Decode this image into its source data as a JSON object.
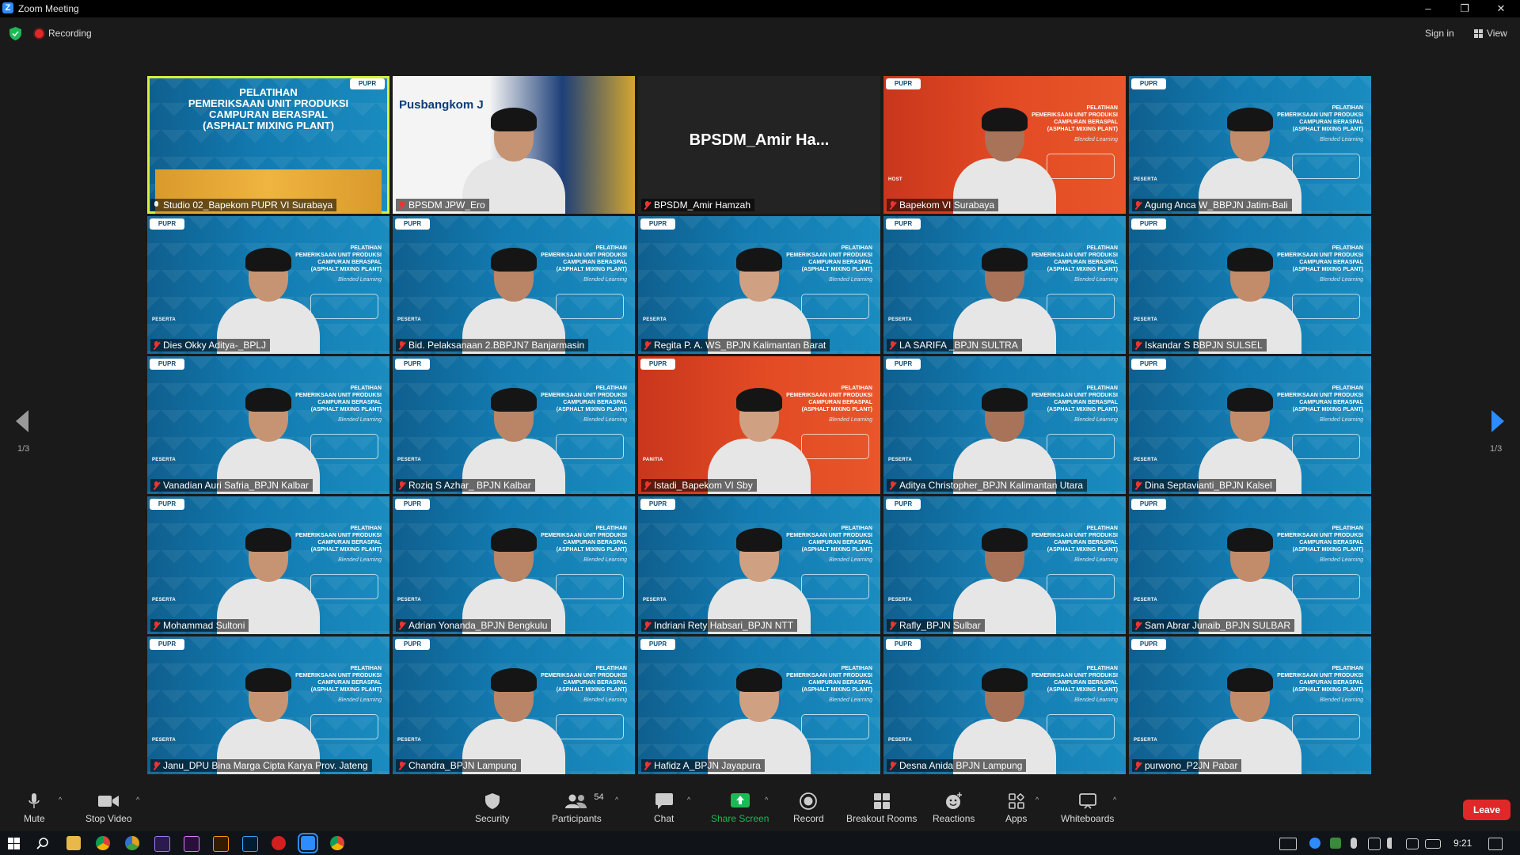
{
  "window": {
    "title": "Zoom Meeting",
    "minimize": "–",
    "restore": "❐",
    "close": "✕"
  },
  "meeting": {
    "recording_label": "Recording",
    "sign_in": "Sign in",
    "view_label": "View"
  },
  "pagination": {
    "left": "1/3",
    "right": "1/3"
  },
  "studio_banner": [
    "PELATIHAN",
    "PEMERIKSAAN UNIT PRODUKSI",
    "CAMPURAN BERASPAL",
    "(ASPHALT MIXING PLANT)"
  ],
  "pusbangkom_label": "Pusbangkom J",
  "big_name": "BPSDM_Amir  Ha...",
  "banner_lines": [
    "PELATIHAN",
    "PEMERIKSAAN UNIT PRODUKSI",
    "CAMPURAN BERASPAL",
    "(ASPHALT MIXING PLANT)"
  ],
  "banner_script": "Blended Learning",
  "roles": {
    "host": "HOST",
    "peserta": "PESERTA",
    "panitia": "PANITIA"
  },
  "participants": [
    {
      "name": "Studio 02_Bapekom PUPR VI Surabaya",
      "bg": "studio",
      "active": true,
      "muted": false
    },
    {
      "name": "BPSDM JPW_Ero",
      "bg": "pusbang",
      "muted": true
    },
    {
      "name": "BPSDM_Amir Hamzah",
      "bg": "dark",
      "muted": true
    },
    {
      "name": "Bapekom VI Surabaya",
      "bg": "orange",
      "role": "HOST",
      "muted": true
    },
    {
      "name": "Agung Anca W_BBPJN Jatim-Bali",
      "bg": "blue",
      "role": "PESERTA",
      "muted": true
    },
    {
      "name": "Dies Okky Aditya-_BPLJ",
      "bg": "blue",
      "role": "PESERTA",
      "muted": true
    },
    {
      "name": "Bid. Pelaksanaan 2.BBPJN7 Banjarmasin",
      "bg": "blue",
      "role": "PESERTA",
      "muted": true
    },
    {
      "name": "Regita P. A. WS_BPJN Kalimantan Barat",
      "bg": "blue",
      "role": "PESERTA",
      "muted": true
    },
    {
      "name": "LA SARIFA _BPJN SULTRA",
      "bg": "blue",
      "role": "PESERTA",
      "muted": true
    },
    {
      "name": "Iskandar S BBPJN SULSEL",
      "bg": "blue",
      "role": "PESERTA",
      "muted": true
    },
    {
      "name": "Vanadian Auri Safria_BPJN Kalbar",
      "bg": "blue",
      "role": "PESERTA",
      "muted": true
    },
    {
      "name": "Roziq S Azhar_ BPJN Kalbar",
      "bg": "blue",
      "role": "PESERTA",
      "muted": true
    },
    {
      "name": "Istadi_Bapekom VI Sby",
      "bg": "orange",
      "role": "PANITIA",
      "muted": true
    },
    {
      "name": "Aditya Christopher_BPJN Kalimantan Utara",
      "bg": "blue",
      "role": "PESERTA",
      "muted": true
    },
    {
      "name": "Dina Septavianti_BPJN Kalsel",
      "bg": "blue",
      "role": "PESERTA",
      "muted": true
    },
    {
      "name": "Mohammad Sultoni",
      "bg": "blue",
      "role": "PESERTA",
      "muted": true
    },
    {
      "name": "Adrian Yonanda_BPJN Bengkulu",
      "bg": "blue",
      "role": "PESERTA",
      "muted": true
    },
    {
      "name": "Indriani Rety Habsari_BPJN NTT",
      "bg": "blue",
      "role": "PESERTA",
      "muted": true
    },
    {
      "name": "Rafly_BPJN Sulbar",
      "bg": "blue",
      "role": "PESERTA",
      "muted": true
    },
    {
      "name": "Sam Abrar Junaib_BPJN SULBAR",
      "bg": "blue",
      "role": "PESERTA",
      "muted": true
    },
    {
      "name": "Janu_DPU Bina Marga Cipta Karya Prov. Jateng",
      "bg": "blue",
      "role": "PESERTA",
      "muted": true
    },
    {
      "name": "Chandra_BPJN Lampung",
      "bg": "blue",
      "role": "PESERTA",
      "muted": true
    },
    {
      "name": "Hafidz A_BPJN Jayapura",
      "bg": "blue",
      "role": "",
      "muted": true
    },
    {
      "name": "Desna Anida BPJN Lampung",
      "bg": "blue",
      "role": "PESERTA",
      "muted": true
    },
    {
      "name": "purwono_P2JN Pabar",
      "bg": "blue",
      "role": "PESERTA",
      "muted": true
    }
  ],
  "toolbar": {
    "mute": "Mute",
    "stop_video": "Stop Video",
    "security": "Security",
    "participants": "Participants",
    "participants_count": "54",
    "chat": "Chat",
    "share_screen": "Share Screen",
    "record": "Record",
    "breakout_rooms": "Breakout Rooms",
    "reactions": "Reactions",
    "apps": "Apps",
    "whiteboards": "Whiteboards",
    "leave": "Leave"
  },
  "taskbar": {
    "clock": "9:21"
  },
  "colors": {
    "zoom_blue": "#2d8cff",
    "leave_red": "#e02828",
    "active_speaker": "#d4f03a",
    "share_green": "#1db954"
  }
}
